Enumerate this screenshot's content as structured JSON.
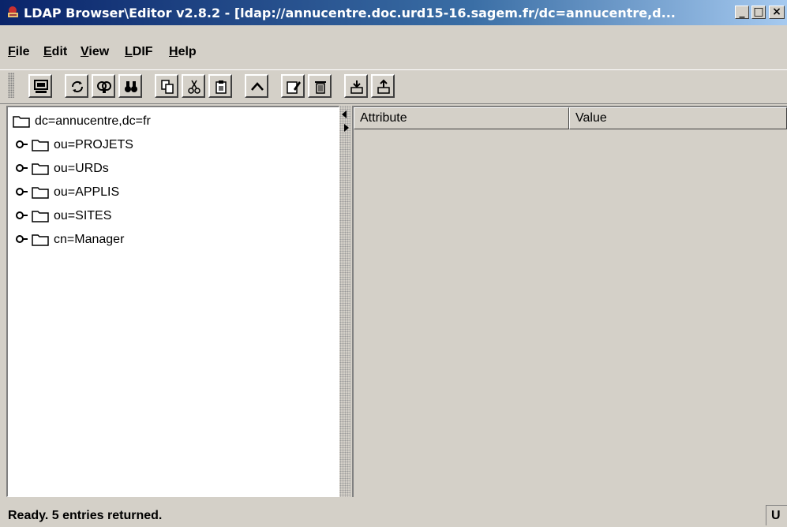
{
  "window": {
    "title": "LDAP Browser\\Editor v2.8.2 - [ldap://annucentre.doc.urd15-16.sagem.fr/dc=annucentre,d...",
    "controls": {
      "minimize": "_",
      "maximize": "□",
      "close": "×"
    }
  },
  "menu": [
    {
      "label": "File",
      "mnemonic": "F",
      "rest": "ile"
    },
    {
      "label": "Edit",
      "mnemonic": "E",
      "rest": "dit"
    },
    {
      "label": "View",
      "mnemonic": "V",
      "rest": "iew"
    },
    {
      "label": "LDIF",
      "mnemonic": "L",
      "rest": "DIF"
    },
    {
      "label": "Help",
      "mnemonic": "H",
      "rest": "elp"
    }
  ],
  "toolbar": {
    "buttons": [
      "connect-icon",
      "refresh-icon",
      "search-icon",
      "find-icon",
      "copy-icon",
      "cut-icon",
      "paste-icon",
      "up-icon",
      "edit-icon",
      "delete-icon",
      "export-icon",
      "import-icon"
    ]
  },
  "tree": {
    "root": "dc=annucentre,dc=fr",
    "children": [
      "ou=PROJETS",
      "ou=URDs",
      "ou=APPLIS",
      "ou=SITES",
      "cn=Manager"
    ]
  },
  "table": {
    "columns": [
      "Attribute",
      "Value"
    ]
  },
  "status": {
    "text": "Ready. 5 entries returned.",
    "right": "U"
  },
  "colors": {
    "title_start": "#0a246a",
    "title_end": "#a6caf0",
    "face": "#d4d0c8"
  }
}
